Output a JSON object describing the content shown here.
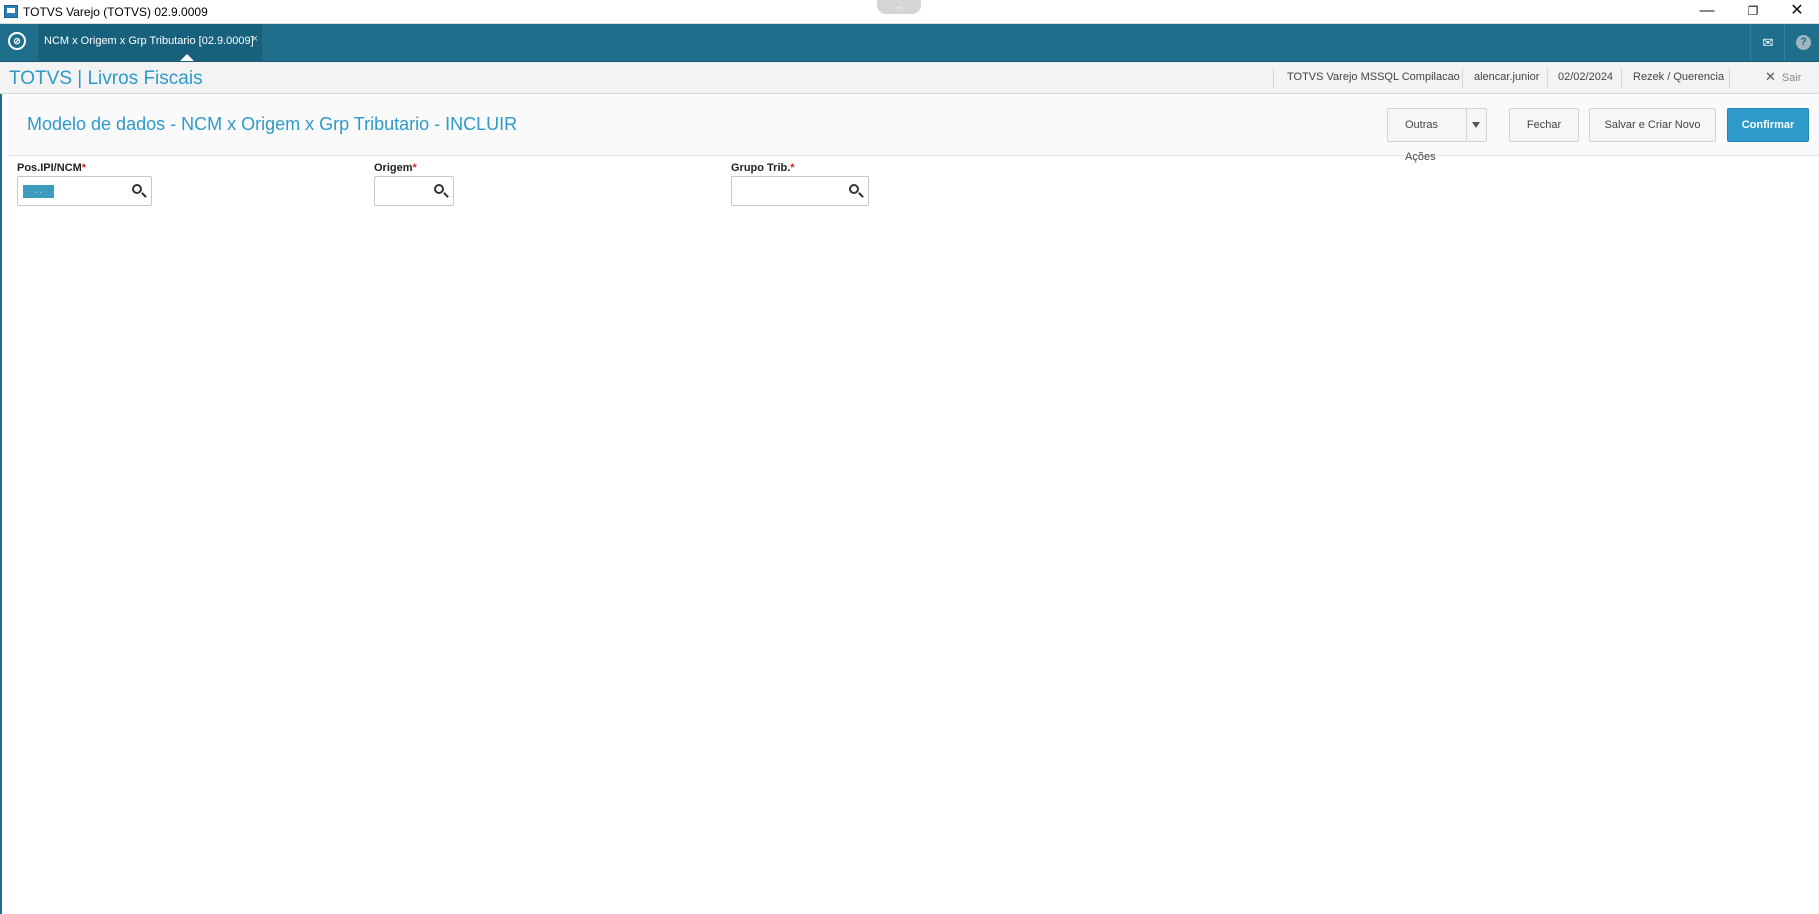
{
  "window": {
    "title": "TOTVS Varejo (TOTVS) 02.9.0009",
    "controls": {
      "minimize": "—",
      "maximize": "❐",
      "close": "✕"
    }
  },
  "tabbar": {
    "tabs": [
      {
        "label": "NCM x Origem x Grp Tributario [02.9.0009]",
        "close": "×"
      }
    ],
    "icons": [
      "home-icon",
      "mail-icon",
      "help-icon"
    ]
  },
  "app": {
    "title": "TOTVS | Livros Fiscais",
    "environment": "TOTVS Varejo MSSQL Compilacao",
    "user": "alencar.junior",
    "date": "02/02/2024",
    "branch": "Rezek / Querencia",
    "exit_label": "Sair"
  },
  "form": {
    "title": "Modelo de dados - NCM x Origem x Grp Tributario - INCLUIR",
    "actions": {
      "outras": "Outras Ações",
      "fechar": "Fechar",
      "salvar_novo": "Salvar e Criar Novo",
      "confirmar": "Confirmar"
    },
    "fields": [
      {
        "label": "Pos.IPI/NCM",
        "required": "*",
        "value": " .  ."
      },
      {
        "label": "Origem",
        "required": "*",
        "value": ""
      },
      {
        "label": "Grupo Trib.",
        "required": "*",
        "value": ""
      }
    ]
  },
  "colors": {
    "tabbar": "#1f6e8c",
    "accent": "#2d9ac9",
    "required": "#e02020"
  }
}
